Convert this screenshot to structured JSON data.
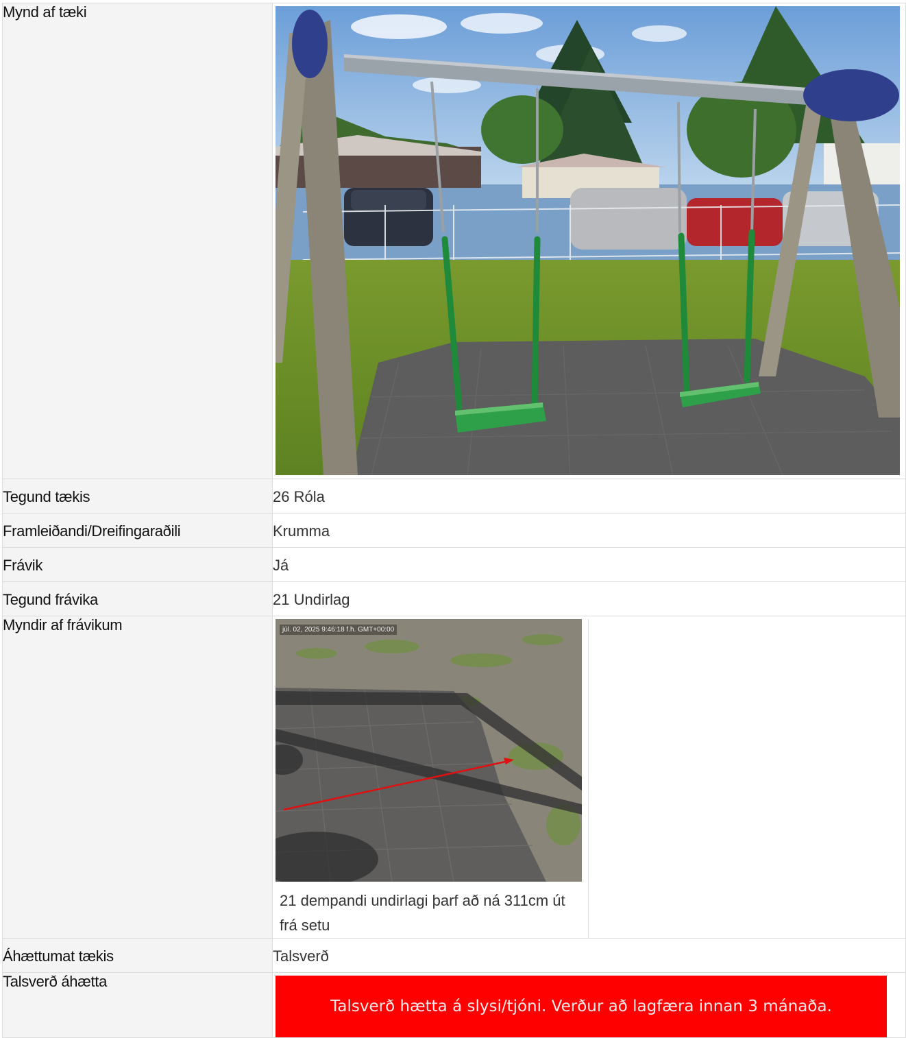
{
  "rows": {
    "photo": {
      "label": "Mynd af tæki"
    },
    "type": {
      "label": "Tegund tækis",
      "value": "26 Róla"
    },
    "manufacturer": {
      "label": "Framleiðandi/Dreifingaraðili",
      "value": "Krumma"
    },
    "deviation": {
      "label": "Frávik",
      "value": "Já"
    },
    "deviation_type": {
      "label": "Tegund frávika",
      "value": "21 Undirlag"
    },
    "deviation_photos": {
      "label": "Myndir af frávikum",
      "timestamp": "júl. 02, 2025 9:46:18 f.h. GMT+00:00",
      "caption": "21 dempandi undirlagi þarf að ná 311cm út frá setu"
    },
    "risk_assessment": {
      "label": "Áhættumat tækis",
      "value": "Talsverð"
    },
    "risk_level": {
      "label": "Talsverð áhætta",
      "banner": "Talsverð hætta á slysi/tjóni. Verður að lagfæra innan 3 mánaða.",
      "banner_color": "#ff0000"
    }
  }
}
